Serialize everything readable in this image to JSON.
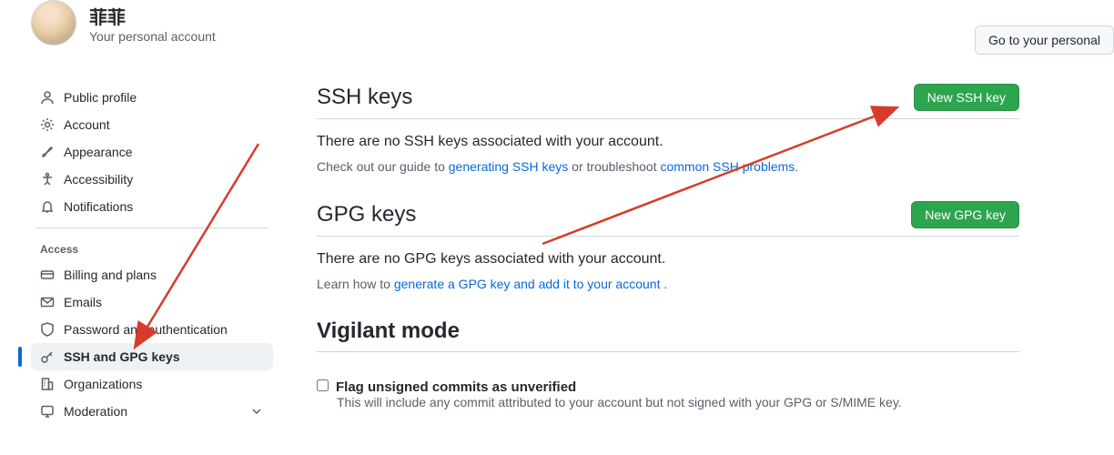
{
  "profile": {
    "name": "菲菲",
    "sub": "Your personal account"
  },
  "goto_button": "Go to your personal",
  "sidebar": {
    "top": [
      {
        "label": "Public profile"
      },
      {
        "label": "Account"
      },
      {
        "label": "Appearance"
      },
      {
        "label": "Accessibility"
      },
      {
        "label": "Notifications"
      }
    ],
    "access_caption": "Access",
    "access": [
      {
        "label": "Billing and plans"
      },
      {
        "label": "Emails"
      },
      {
        "label": "Password and authentication"
      },
      {
        "label": "SSH and GPG keys"
      },
      {
        "label": "Organizations"
      },
      {
        "label": "Moderation"
      }
    ]
  },
  "ssh": {
    "title": "SSH keys",
    "new_btn": "New SSH key",
    "empty": "There are no SSH keys associated with your account.",
    "help_prefix": "Check out our guide to ",
    "help_link1": "generating SSH keys",
    "help_mid": " or troubleshoot ",
    "help_link2": "common SSH problems",
    "help_suffix": "."
  },
  "gpg": {
    "title": "GPG keys",
    "new_btn": "New GPG key",
    "empty": "There are no GPG keys associated with your account.",
    "help_prefix": "Learn how to ",
    "help_link1": "generate a GPG key and add it to your account",
    "help_suffix": " ."
  },
  "vigilant": {
    "title": "Vigilant mode",
    "check_label": "Flag unsigned commits as unverified",
    "check_desc": "This will include any commit attributed to your account but not signed with your GPG or S/MIME key."
  }
}
